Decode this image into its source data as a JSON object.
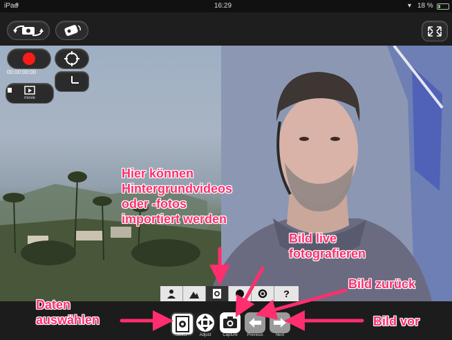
{
  "status_bar": {
    "device": "iPad",
    "time": "16:29",
    "battery": "18 %"
  },
  "recorder": {
    "timecode": "00:00:00:00",
    "movie_label": "movie"
  },
  "bottom_toolbar": {
    "buttons": [
      {
        "label": "Select"
      },
      {
        "label": "Adjust"
      },
      {
        "label": "Capture"
      },
      {
        "label": "Previous"
      },
      {
        "label": "Next"
      }
    ],
    "help_label": "?"
  },
  "annotations": {
    "import_line1": "Hier können",
    "import_line2": "Hintergrundvideos",
    "import_line3": "oder -fotos",
    "import_line4": "importiert werden",
    "live_line1": "Bild live",
    "live_line2": "fotografieren",
    "back": "Bild zurück",
    "select_line1": "Daten",
    "select_line2": "auswählen",
    "next": "Bild vor"
  },
  "colors": {
    "callout": "#ff2e6e",
    "record": "#ff1a1a"
  }
}
